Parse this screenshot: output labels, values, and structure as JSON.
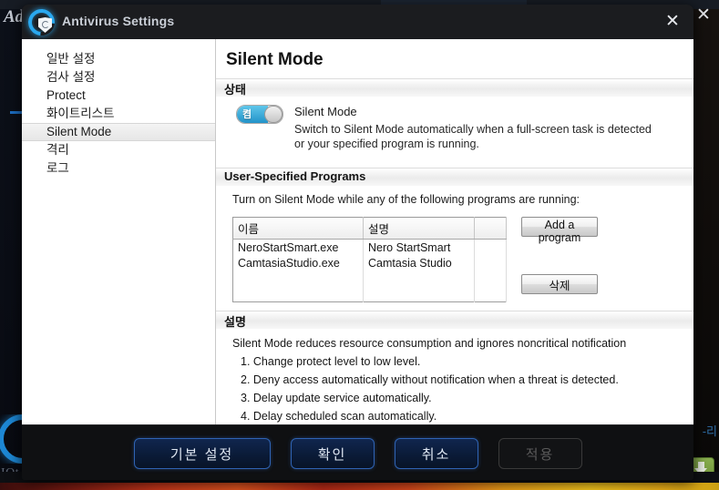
{
  "background": {
    "ghost_title": "Ad",
    "logo_text": "IOt",
    "right_label": "-리",
    "download_icon": "download-icon",
    "outer_close_icon": "✕"
  },
  "dialog": {
    "title": "Antivirus Settings",
    "logo_icon": "antivirus-shield-logo",
    "close_icon": "✕"
  },
  "sidebar": {
    "items": [
      {
        "label": "일반 설정",
        "selected": false
      },
      {
        "label": "검사 설정",
        "selected": false
      },
      {
        "label": "Protect",
        "selected": false
      },
      {
        "label": "화이트리스트",
        "selected": false
      },
      {
        "label": "Silent Mode",
        "selected": true
      },
      {
        "label": "격리",
        "selected": false
      },
      {
        "label": "로그",
        "selected": false
      }
    ]
  },
  "content": {
    "page_title": "Silent Mode",
    "status_section": {
      "header": "상태",
      "toggle": {
        "state_label": "켬",
        "on": true,
        "accent": "#2293c9"
      },
      "item_name": "Silent Mode",
      "item_desc": "Switch to Silent Mode automatically when a full-screen task is detected or your specified program is running."
    },
    "programs_section": {
      "header": "User-Specified Programs",
      "instruction": "Turn on Silent Mode while any of the following programs are running:",
      "table": {
        "columns": [
          "이름",
          "설명",
          ""
        ],
        "rows": [
          [
            "NeroStartSmart.exe",
            "Nero StartSmart",
            ""
          ],
          [
            "CamtasiaStudio.exe",
            "Camtasia Studio",
            ""
          ]
        ],
        "empty_rows": 2
      },
      "add_button": "Add a program",
      "delete_button": "삭제"
    },
    "description_section": {
      "header": "설명",
      "intro": "Silent Mode reduces resource consumption and ignores noncritical notification",
      "items": [
        "1. Change protect level to low level.",
        "2. Deny access automatically without notification when a threat is detected.",
        "3. Delay update service automatically.",
        "4. Delay scheduled scan automatically."
      ]
    }
  },
  "footer": {
    "buttons": [
      {
        "label": "기본 설정",
        "disabled": false
      },
      {
        "label": "확인",
        "disabled": false
      },
      {
        "label": "취소",
        "disabled": false
      },
      {
        "label": "적용",
        "disabled": true
      }
    ]
  }
}
